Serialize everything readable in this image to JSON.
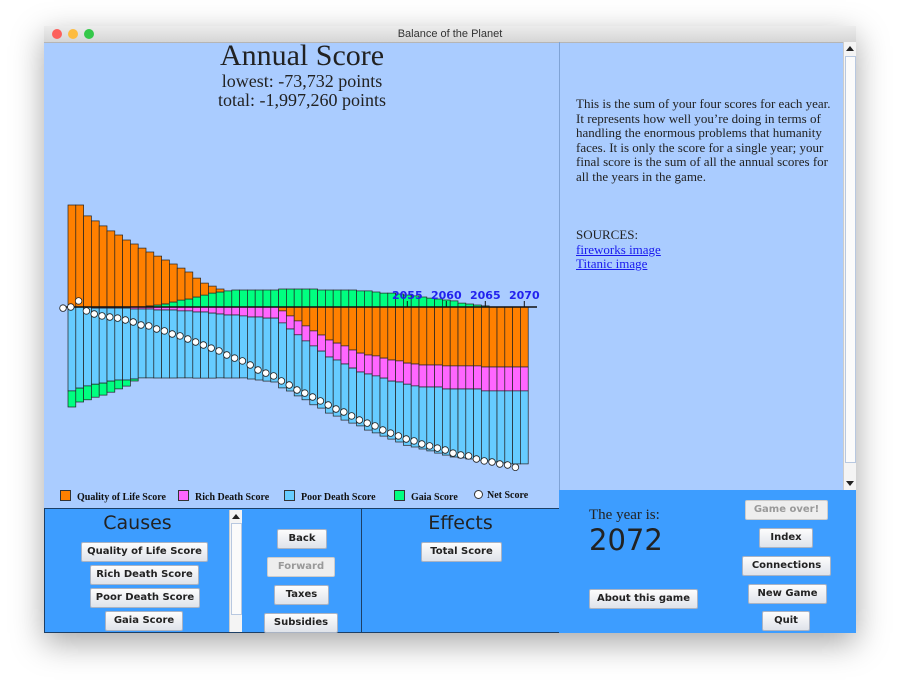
{
  "window": {
    "title": "Balance of the Planet"
  },
  "chart_header": {
    "title": "Annual Score",
    "lowest": "lowest: -73,732 points",
    "total": "total: -1,997,260 points"
  },
  "description": {
    "text": "This is the sum of your four scores for each year. It represents how well you’re doing in terms of handling the enormous problems that humanity faces. It is only the score for a single year; your final score is the sum of all the annual scores for all the years in the game.",
    "sources_label": "SOURCES:",
    "links": [
      "fireworks image",
      "Titanic image"
    ]
  },
  "causes": {
    "title": "Causes",
    "buttons": [
      "Quality of Life Score",
      "Rich Death Score",
      "Poor Death Score",
      "Gaia Score"
    ]
  },
  "nav": {
    "back": "Back",
    "forward": "Forward",
    "taxes": "Taxes",
    "subsidies": "Subsidies"
  },
  "effects": {
    "title": "Effects",
    "buttons": [
      "Total Score"
    ]
  },
  "status": {
    "year_label": "The year is:",
    "year": "2072",
    "about": "About this game",
    "game_over": "Game over!",
    "index": "Index",
    "connections": "Connections",
    "new_game": "New Game",
    "quit": "Quit"
  },
  "chart_data": {
    "type": "bar",
    "stacked": true,
    "x_start": 2012,
    "tick_labels": [
      "2055",
      "2060",
      "2065",
      "2070"
    ],
    "colors": {
      "qol": "#ff8000",
      "rich": "#ff66ff",
      "poor": "#66ccff",
      "gaia": "#00ff80",
      "net": "#ffffff"
    },
    "legend": [
      "Quality of Life Score",
      "Rich Death Score",
      "Poor Death Score",
      "Gaia Score",
      "Net Score"
    ],
    "legend_position": "bottom",
    "series": {
      "qol": [
        46900,
        46900,
        41900,
        39600,
        37300,
        35000,
        33100,
        30800,
        29000,
        27100,
        24800,
        22500,
        20200,
        17500,
        14700,
        12400,
        8700,
        5500,
        3200,
        1400,
        0,
        0,
        0,
        0,
        0,
        0,
        0,
        -1800,
        -4100,
        -6400,
        -8700,
        -11000,
        -12900,
        -15200,
        -16600,
        -17900,
        -19800,
        -21200,
        -22100,
        -22500,
        -23500,
        -24400,
        -24800,
        -25800,
        -26200,
        -26700,
        -26700,
        -26700,
        -27100,
        -27100,
        -27100,
        -27100,
        -27100,
        -27600,
        -27600,
        -27600,
        -27600,
        -27600,
        -27600
      ],
      "rich": [
        0,
        0,
        0,
        -500,
        -500,
        -500,
        -500,
        -500,
        -900,
        -900,
        -900,
        -1400,
        -1400,
        -1400,
        -1800,
        -1800,
        -2300,
        -2300,
        -2800,
        -3200,
        -3700,
        -3700,
        -4100,
        -4600,
        -4600,
        -5100,
        -5100,
        -5500,
        -6000,
        -6400,
        -6900,
        -6900,
        -7400,
        -7800,
        -7800,
        -8300,
        -8300,
        -8700,
        -8700,
        -9200,
        -9200,
        -9700,
        -9700,
        -9700,
        -10100,
        -10100,
        -10100,
        -10100,
        -10600,
        -10600,
        -10600,
        -10600,
        -10600,
        -11000,
        -11000,
        -11000,
        -11000,
        -11000,
        -11000
      ],
      "poor": [
        -38600,
        -37300,
        -36300,
        -35000,
        -34500,
        -33600,
        -33100,
        -33100,
        -32200,
        -31700,
        -31700,
        -31300,
        -31300,
        -31300,
        -30800,
        -30800,
        -30400,
        -30400,
        -29900,
        -29400,
        -29000,
        -29000,
        -28500,
        -28500,
        -29000,
        -29000,
        -29400,
        -29900,
        -28500,
        -28100,
        -27100,
        -27100,
        -26200,
        -25800,
        -25800,
        -25800,
        -25300,
        -24800,
        -25800,
        -26200,
        -26700,
        -26700,
        -27600,
        -28100,
        -28100,
        -28500,
        -29400,
        -30400,
        -30400,
        -31300,
        -31700,
        -32200,
        -32700,
        -32200,
        -32700,
        -33100,
        -33600,
        -33600,
        -33600
      ],
      "gaia": [
        -7400,
        -6400,
        -6400,
        -6000,
        -5500,
        -5100,
        -4100,
        -2800,
        -900,
        0,
        500,
        900,
        1400,
        2300,
        3200,
        3700,
        4600,
        5500,
        6400,
        6900,
        7400,
        7800,
        7800,
        7800,
        7800,
        7800,
        7800,
        8300,
        8300,
        8300,
        8300,
        8300,
        7800,
        7800,
        7800,
        7800,
        7800,
        7400,
        7400,
        6900,
        6400,
        6400,
        6000,
        5500,
        5100,
        4600,
        4100,
        3700,
        3200,
        2800,
        1800,
        1400,
        900,
        500,
        0,
        0,
        0,
        0,
        0
      ],
      "net": [
        -500,
        0,
        2800,
        -1800,
        -3200,
        -4100,
        -4600,
        -5100,
        -6000,
        -6900,
        -8300,
        -8700,
        -10100,
        -11000,
        -12400,
        -13300,
        -14700,
        -16100,
        -17500,
        -18900,
        -20200,
        -22100,
        -23500,
        -24800,
        -26700,
        -29000,
        -30400,
        -31700,
        -34000,
        -35900,
        -38200,
        -39600,
        -41400,
        -43200,
        -45100,
        -46900,
        -48300,
        -50100,
        -52000,
        -53400,
        -54700,
        -56600,
        -58000,
        -59300,
        -60700,
        -61600,
        -63000,
        -63900,
        -64900,
        -65800,
        -67200,
        -68100,
        -68500,
        -69900,
        -70800,
        -71300,
        -72200,
        -72700,
        -73732
      ]
    }
  }
}
